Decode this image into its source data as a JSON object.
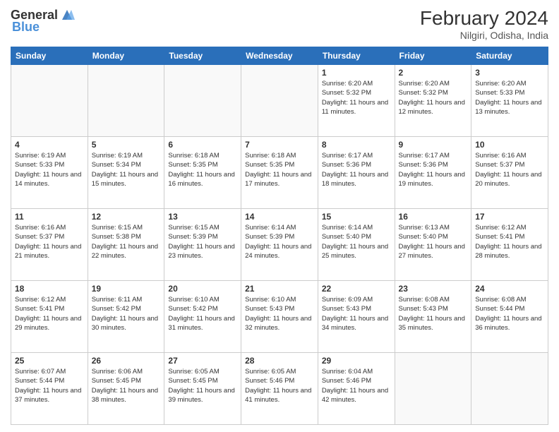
{
  "header": {
    "logo_general": "General",
    "logo_blue": "Blue",
    "month_year": "February 2024",
    "location": "Nilgiri, Odisha, India"
  },
  "days_of_week": [
    "Sunday",
    "Monday",
    "Tuesday",
    "Wednesday",
    "Thursday",
    "Friday",
    "Saturday"
  ],
  "weeks": [
    [
      {
        "day": "",
        "info": ""
      },
      {
        "day": "",
        "info": ""
      },
      {
        "day": "",
        "info": ""
      },
      {
        "day": "",
        "info": ""
      },
      {
        "day": "1",
        "info": "Sunrise: 6:20 AM\nSunset: 5:32 PM\nDaylight: 11 hours and 11 minutes."
      },
      {
        "day": "2",
        "info": "Sunrise: 6:20 AM\nSunset: 5:32 PM\nDaylight: 11 hours and 12 minutes."
      },
      {
        "day": "3",
        "info": "Sunrise: 6:20 AM\nSunset: 5:33 PM\nDaylight: 11 hours and 13 minutes."
      }
    ],
    [
      {
        "day": "4",
        "info": "Sunrise: 6:19 AM\nSunset: 5:33 PM\nDaylight: 11 hours and 14 minutes."
      },
      {
        "day": "5",
        "info": "Sunrise: 6:19 AM\nSunset: 5:34 PM\nDaylight: 11 hours and 15 minutes."
      },
      {
        "day": "6",
        "info": "Sunrise: 6:18 AM\nSunset: 5:35 PM\nDaylight: 11 hours and 16 minutes."
      },
      {
        "day": "7",
        "info": "Sunrise: 6:18 AM\nSunset: 5:35 PM\nDaylight: 11 hours and 17 minutes."
      },
      {
        "day": "8",
        "info": "Sunrise: 6:17 AM\nSunset: 5:36 PM\nDaylight: 11 hours and 18 minutes."
      },
      {
        "day": "9",
        "info": "Sunrise: 6:17 AM\nSunset: 5:36 PM\nDaylight: 11 hours and 19 minutes."
      },
      {
        "day": "10",
        "info": "Sunrise: 6:16 AM\nSunset: 5:37 PM\nDaylight: 11 hours and 20 minutes."
      }
    ],
    [
      {
        "day": "11",
        "info": "Sunrise: 6:16 AM\nSunset: 5:37 PM\nDaylight: 11 hours and 21 minutes."
      },
      {
        "day": "12",
        "info": "Sunrise: 6:15 AM\nSunset: 5:38 PM\nDaylight: 11 hours and 22 minutes."
      },
      {
        "day": "13",
        "info": "Sunrise: 6:15 AM\nSunset: 5:39 PM\nDaylight: 11 hours and 23 minutes."
      },
      {
        "day": "14",
        "info": "Sunrise: 6:14 AM\nSunset: 5:39 PM\nDaylight: 11 hours and 24 minutes."
      },
      {
        "day": "15",
        "info": "Sunrise: 6:14 AM\nSunset: 5:40 PM\nDaylight: 11 hours and 25 minutes."
      },
      {
        "day": "16",
        "info": "Sunrise: 6:13 AM\nSunset: 5:40 PM\nDaylight: 11 hours and 27 minutes."
      },
      {
        "day": "17",
        "info": "Sunrise: 6:12 AM\nSunset: 5:41 PM\nDaylight: 11 hours and 28 minutes."
      }
    ],
    [
      {
        "day": "18",
        "info": "Sunrise: 6:12 AM\nSunset: 5:41 PM\nDaylight: 11 hours and 29 minutes."
      },
      {
        "day": "19",
        "info": "Sunrise: 6:11 AM\nSunset: 5:42 PM\nDaylight: 11 hours and 30 minutes."
      },
      {
        "day": "20",
        "info": "Sunrise: 6:10 AM\nSunset: 5:42 PM\nDaylight: 11 hours and 31 minutes."
      },
      {
        "day": "21",
        "info": "Sunrise: 6:10 AM\nSunset: 5:43 PM\nDaylight: 11 hours and 32 minutes."
      },
      {
        "day": "22",
        "info": "Sunrise: 6:09 AM\nSunset: 5:43 PM\nDaylight: 11 hours and 34 minutes."
      },
      {
        "day": "23",
        "info": "Sunrise: 6:08 AM\nSunset: 5:43 PM\nDaylight: 11 hours and 35 minutes."
      },
      {
        "day": "24",
        "info": "Sunrise: 6:08 AM\nSunset: 5:44 PM\nDaylight: 11 hours and 36 minutes."
      }
    ],
    [
      {
        "day": "25",
        "info": "Sunrise: 6:07 AM\nSunset: 5:44 PM\nDaylight: 11 hours and 37 minutes."
      },
      {
        "day": "26",
        "info": "Sunrise: 6:06 AM\nSunset: 5:45 PM\nDaylight: 11 hours and 38 minutes."
      },
      {
        "day": "27",
        "info": "Sunrise: 6:05 AM\nSunset: 5:45 PM\nDaylight: 11 hours and 39 minutes."
      },
      {
        "day": "28",
        "info": "Sunrise: 6:05 AM\nSunset: 5:46 PM\nDaylight: 11 hours and 41 minutes."
      },
      {
        "day": "29",
        "info": "Sunrise: 6:04 AM\nSunset: 5:46 PM\nDaylight: 11 hours and 42 minutes."
      },
      {
        "day": "",
        "info": ""
      },
      {
        "day": "",
        "info": ""
      }
    ]
  ]
}
